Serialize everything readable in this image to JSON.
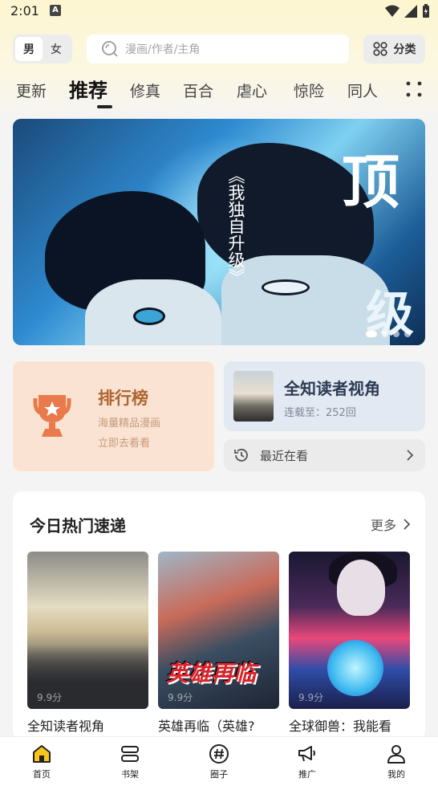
{
  "status_bar": {
    "time": "2:01",
    "notification_icon": "A"
  },
  "header": {
    "gender": {
      "male": "男",
      "female": "女"
    },
    "search_placeholder": "漫画/作者/主角",
    "category_label": "分类"
  },
  "tabs": [
    "更新",
    "推荐",
    "修真",
    "百合",
    "虐心",
    "惊险",
    "同人"
  ],
  "active_tab": "推荐",
  "banner": {
    "vertical_title": "《我独自升级》",
    "big_text_1": "顶",
    "big_text_2": "级",
    "slide_count": 4,
    "active_slide": 1
  },
  "ranking_card": {
    "title": "排行榜",
    "subtitle": "海量精品漫画",
    "action": "立即去看看",
    "accent": "#b0642f"
  },
  "continue_card": {
    "title": "全知读者视角",
    "progress": "连载至：252回"
  },
  "recent": {
    "label": "最近在看"
  },
  "hot": {
    "title": "今日热门速递",
    "more_label": "更多",
    "items": [
      {
        "name": "全知读者视角",
        "score": "9.9分"
      },
      {
        "name": "英雄再临（英雄?",
        "score": "9.9分",
        "logo": "英雄再临"
      },
      {
        "name": "全球御兽：我能看",
        "score": "9.9分"
      }
    ]
  },
  "bottom_nav": [
    {
      "label": "首页",
      "icon": "home-icon",
      "active": true
    },
    {
      "label": "书架",
      "icon": "bookshelf-icon",
      "active": false
    },
    {
      "label": "圈子",
      "icon": "hashtag-icon",
      "active": false
    },
    {
      "label": "推广",
      "icon": "megaphone-icon",
      "active": false
    },
    {
      "label": "我的",
      "icon": "person-icon",
      "active": false
    }
  ]
}
